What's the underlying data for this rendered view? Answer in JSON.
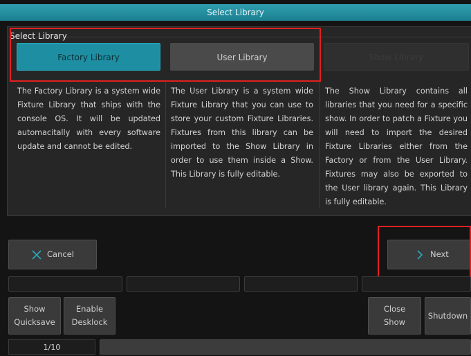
{
  "dialog": {
    "title": "Select Library"
  },
  "select_library": {
    "group_label": "Select Library",
    "buttons": [
      {
        "label": "Factory Library",
        "state": "active"
      },
      {
        "label": "User Library",
        "state": "normal"
      },
      {
        "label": "Show Library",
        "state": "disabled"
      }
    ],
    "descriptions": [
      "The Factory Library is a system wide Fixture Library that ships with the console OS. It will be updated automacitally with every software update and cannot be edited.",
      "The User Library is a system wide Fixture Library that you can use to store your custom Fixture Libraries. Fixtures from this library can be imported to the Show Library in order to use them inside a Show. This Library is fully editable.",
      "The Show Library contains all libraries that you need for a specific show. In order to patch a Fixture you will need to import the desired Fixture Libraries either from the Factory or from the User Library. Fixtures may also be exported to the User library again. This Library is fully editable."
    ]
  },
  "actions": {
    "cancel_label": "Cancel",
    "next_label": "Next"
  },
  "bottom": {
    "show_quicksave": [
      "Show",
      "Quicksave"
    ],
    "enable_desklock": [
      "Enable",
      "Desklock"
    ],
    "close_show": [
      "Close",
      "Show"
    ],
    "shutdown": "Shutdown",
    "page_indicator": "1/10"
  },
  "colors": {
    "accent": "#1e8fa3",
    "highlight": "#e02020"
  }
}
